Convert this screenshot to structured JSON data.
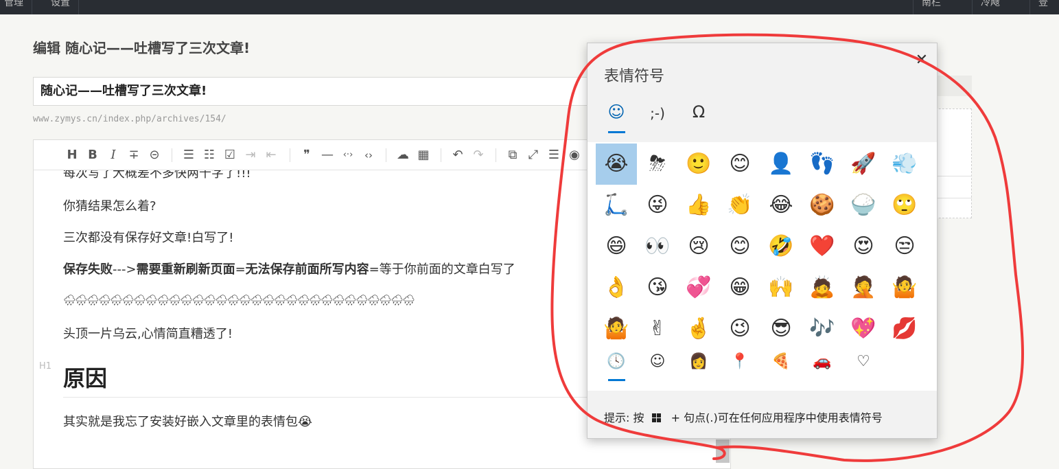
{
  "topbar": {
    "left_items": [
      "管理",
      "设置"
    ],
    "right_items": [
      "南栏",
      "冷飕",
      "登"
    ]
  },
  "page_title": "编辑 随心记——吐槽写了三次文章!",
  "title_input": {
    "value": "随心记——吐槽写了三次文章!"
  },
  "url_hint": "www.zymys.cn/index.php/archives/154/",
  "toolbar": {
    "heading": "H",
    "bold": "B",
    "italic": "I",
    "strike": "∓",
    "link": "⊝",
    "ul": "☰",
    "ol": "☷",
    "task": "☑",
    "indent": "⇥",
    "outdent": "⇤",
    "quote": "❞",
    "hr": "—",
    "inline_code": "‹·›",
    "code": "‹›",
    "upload": "☁",
    "table": "▦",
    "undo": "↶",
    "redo": "↷",
    "popout": "⧉",
    "fullscreen": "⤢",
    "align": "☰",
    "preview": "◉"
  },
  "content": {
    "line0": "每次写了大概差不多快两千字了!!!",
    "line1": "你猜结果怎么着?",
    "line2": "三次都没有保存好文章!白写了!",
    "line3_a": "保存失败",
    "line3_b": "--->",
    "line3_c": "需要重新刷新页面",
    "line3_d": "=",
    "line3_e": "无法保存前面所写内容",
    "line3_f": "=等于你前面的文章白写了",
    "line4": "🌧🌧🌧🌧🌧🌧🌧🌧🌧🌧🌧🌧🌧🌧🌧🌧🌧🌧🌧🌧🌧🌧🌧🌧🌧🌧🌧🌧🌧🌧",
    "line5": "头顶一片乌云,心情简直糟透了!",
    "h1_mark": "H1",
    "h1": "原因",
    "line6": "其实就是我忘了安装好嵌入文章里的表情包😭"
  },
  "emoji_panel": {
    "title": "表情符号",
    "close": "✕",
    "tabs": [
      "☺",
      ";-)",
      "Ω"
    ],
    "emojis": [
      [
        "😭",
        "⛈",
        "🙂",
        "😊",
        "👤",
        "👣",
        "🚀",
        "💨"
      ],
      [
        "🛴",
        "😜",
        "👍",
        "👏",
        "😂",
        "🍪",
        "🍚",
        "🙄"
      ],
      [
        "😄",
        "👀",
        "😢",
        "😊",
        "🤣",
        "❤️",
        "😍",
        "😒"
      ],
      [
        "👌",
        "😘",
        "💞",
        "😁",
        "🙌",
        "🙇",
        "🤦",
        "🤷"
      ],
      [
        "🤷",
        "✌",
        "🤞",
        "😉",
        "😎",
        "🎶",
        "💖",
        "💋"
      ]
    ],
    "bottom_tabs": [
      "🕓",
      "☺",
      "👩",
      "📍",
      "🍕",
      "🚗",
      "♡"
    ],
    "hint_prefix": "提示: 按",
    "hint_suffix": "+ 句点(.)可在任何应用程序中使用表情符号"
  },
  "colors": {
    "annotation": "#ef3b3b",
    "accent": "#0078d4",
    "topbar": "#292d33"
  }
}
